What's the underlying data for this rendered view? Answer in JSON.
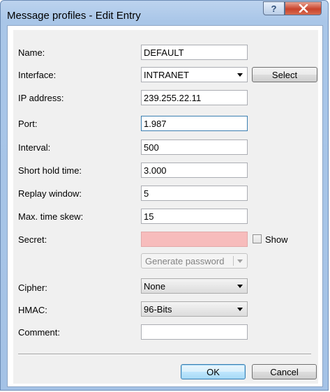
{
  "window": {
    "title": "Message profiles - Edit Entry",
    "help_label": "?",
    "close_label": "✕"
  },
  "form": {
    "name": {
      "label": "Name:",
      "value": "DEFAULT"
    },
    "interface": {
      "label": "Interface:",
      "value": "INTRANET",
      "select_label": "Select"
    },
    "ip_address": {
      "label": "IP address:",
      "value": "239.255.22.11"
    },
    "port": {
      "label": "Port:",
      "value": "1.987"
    },
    "interval": {
      "label": "Interval:",
      "value": "500"
    },
    "short_hold_time": {
      "label": "Short hold time:",
      "value": "3.000"
    },
    "replay_window": {
      "label": "Replay window:",
      "value": "5"
    },
    "max_time_skew": {
      "label": "Max. time skew:",
      "value": "15"
    },
    "secret": {
      "label": "Secret:",
      "value": "",
      "show_label": "Show",
      "generate_label": "Generate password"
    },
    "cipher": {
      "label": "Cipher:",
      "value": "None"
    },
    "hmac": {
      "label": "HMAC:",
      "value": "96-Bits"
    },
    "comment": {
      "label": "Comment:",
      "value": ""
    }
  },
  "buttons": {
    "ok": "OK",
    "cancel": "Cancel"
  },
  "colors": {
    "secret_invalid_bg": "#f7bcbc",
    "title_bar": "#a9c6e8",
    "focus_border": "#3c7fb1"
  }
}
